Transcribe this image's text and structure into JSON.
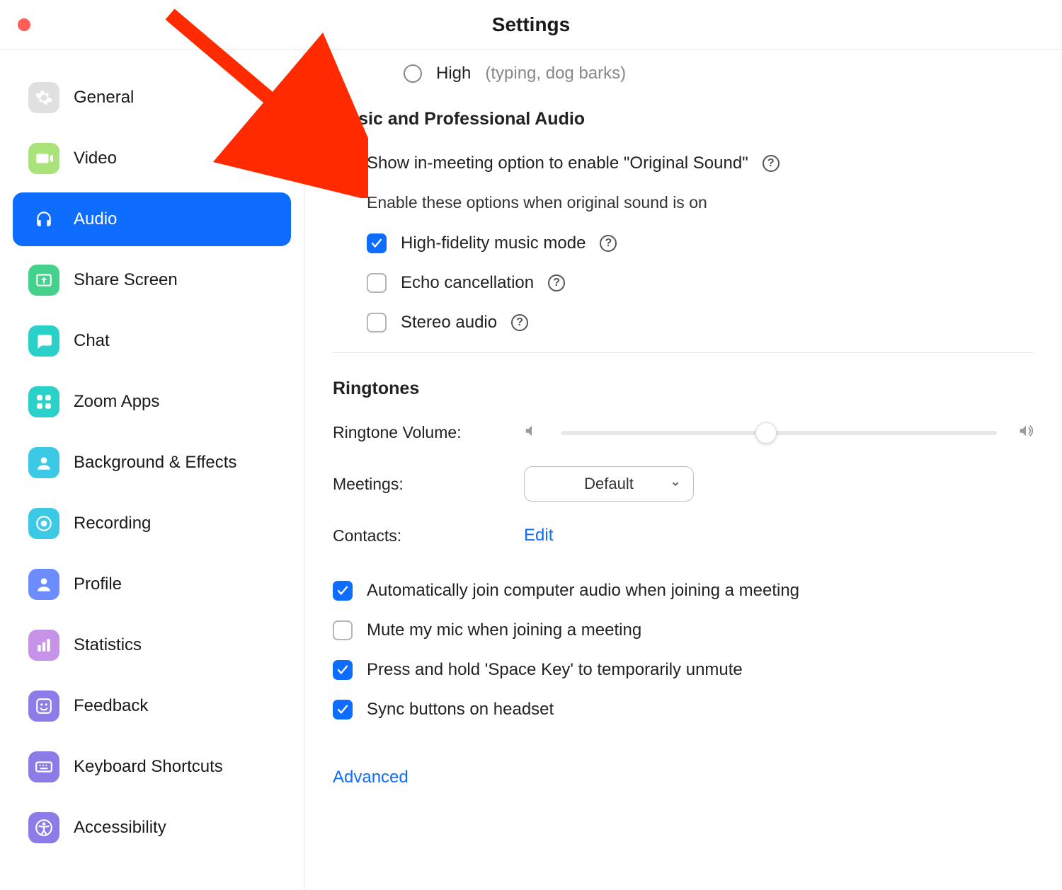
{
  "title": "Settings",
  "sidebar": [
    {
      "label": "General",
      "color": "#e0e0e0",
      "icon": "gear"
    },
    {
      "label": "Video",
      "color": "#a9e37a",
      "icon": "video"
    },
    {
      "label": "Audio",
      "color": "#0e6dff",
      "icon": "headphones",
      "active": true
    },
    {
      "label": "Share Screen",
      "color": "#43d18c",
      "icon": "share"
    },
    {
      "label": "Chat",
      "color": "#2ad1c9",
      "icon": "chat"
    },
    {
      "label": "Zoom Apps",
      "color": "#2ad1c9",
      "icon": "apps"
    },
    {
      "label": "Background & Effects",
      "color": "#3cc9e6",
      "icon": "bg"
    },
    {
      "label": "Recording",
      "color": "#3cc9e6",
      "icon": "rec"
    },
    {
      "label": "Profile",
      "color": "#6c8cff",
      "icon": "profile"
    },
    {
      "label": "Statistics",
      "color": "#c693e8",
      "icon": "stats"
    },
    {
      "label": "Feedback",
      "color": "#8c7ce8",
      "icon": "feedback"
    },
    {
      "label": "Keyboard Shortcuts",
      "color": "#8c7ce8",
      "icon": "keyboard"
    },
    {
      "label": "Accessibility",
      "color": "#8c7ce8",
      "icon": "accessibility"
    }
  ],
  "noise": {
    "high_label": "High",
    "high_hint": "(typing, dog barks)"
  },
  "music_section": {
    "title": "Music and Professional Audio",
    "original_sound": "Show in-meeting option to enable \"Original Sound\"",
    "enable_desc": "Enable these options when original sound is on",
    "hifi": "High-fidelity music mode",
    "echo": "Echo cancellation",
    "stereo": "Stereo audio"
  },
  "ringtones": {
    "title": "Ringtones",
    "volume_label": "Ringtone Volume:",
    "meetings_label": "Meetings:",
    "meetings_value": "Default",
    "contacts_label": "Contacts:",
    "contacts_action": "Edit"
  },
  "options": {
    "auto_join": "Automatically join computer audio when joining a meeting",
    "mute_mic": "Mute my mic when joining a meeting",
    "space_key": "Press and hold 'Space Key' to temporarily unmute",
    "sync_headset": "Sync buttons on headset"
  },
  "advanced": "Advanced"
}
